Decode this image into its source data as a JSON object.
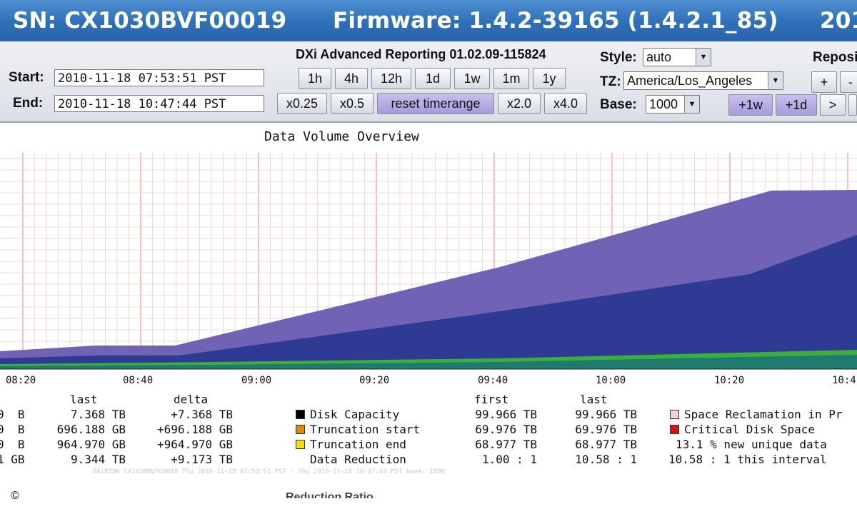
{
  "header": {
    "serial": "SN: CX1030BVF00019",
    "firmware": "Firmware: 1.4.2-39165 (1.4.2.1_85)",
    "year_cut": "201"
  },
  "toolbar": {
    "app_title": "DXi Advanced Reporting 01.02.09-115824",
    "start_label": "Start:",
    "start_value": "2010-11-18 07:53:51 PST",
    "end_label": "End:",
    "end_value": "2010-11-18 10:47:44 PST",
    "range_buttons": [
      "1h",
      "4h",
      "12h",
      "1d",
      "1w",
      "1m",
      "1y"
    ],
    "zoom_buttons": [
      "x0.25",
      "x0.5",
      "reset timerange",
      "x2.0",
      "x4.0"
    ],
    "style_label": "Style:",
    "style_value": "auto",
    "tz_label": "TZ:",
    "tz_value": "America/Los_Angeles",
    "base_label": "Base:",
    "base_value": "1000",
    "repos_label": "Reposi",
    "repos_buttons": [
      "+",
      "-"
    ],
    "shift_buttons": [
      "+1w",
      "+1d",
      ">"
    ]
  },
  "chart_data": {
    "type": "area",
    "title": "Data Volume Overview",
    "x_ticks": [
      "08:20",
      "08:40",
      "09:00",
      "09:20",
      "09:40",
      "10:00",
      "10:20",
      "10:4"
    ],
    "grid": true,
    "series": [
      {
        "color": "#7062b4",
        "role": "top"
      },
      {
        "color": "#2e3a94",
        "role": "middle"
      },
      {
        "color": "#3cae3a",
        "role": "line"
      },
      {
        "color": "#1f7a70",
        "role": "base"
      }
    ]
  },
  "legend": {
    "left_headers": {
      "last": "last",
      "delta": "delta"
    },
    "left_rows": [
      {
        "prefix": "0  B",
        "last": "7.368 TB",
        "delta": "+7.368 TB"
      },
      {
        "prefix": "0  B",
        "last": "696.188 GB",
        "delta": "+696.188 GB"
      },
      {
        "prefix": "0  B",
        "last": "964.970 GB",
        "delta": "+964.970 GB"
      },
      {
        "prefix": "1 GB",
        "last": "9.344 TB",
        "delta": "+9.173 TB"
      }
    ],
    "mid_headers": {
      "first": "first",
      "last": "last"
    },
    "mid_rows": [
      {
        "label": "Disk Capacity",
        "color": "#000000",
        "first": "99.966 TB",
        "last": "99.966 TB"
      },
      {
        "label": "Truncation start",
        "color": "#e08a10",
        "first": "69.976 TB",
        "last": "69.976 TB"
      },
      {
        "label": "Truncation end",
        "color": "#f0e010",
        "first": "68.977 TB",
        "last": "68.977 TB"
      },
      {
        "label": "Data Reduction",
        "first": "1.00 : 1",
        "last": "10.58 : 1"
      }
    ],
    "right_rows": [
      {
        "label": "Space Reclamation in Pr",
        "color": "#f4d0d8"
      },
      {
        "label": "Critical Disk Space",
        "color": "#d01818"
      },
      {
        "label": "13.1 % new unique data"
      },
      {
        "label": "10.58 : 1 this interval"
      }
    ]
  },
  "footer": {
    "faint_text": "DXiRTDR  CX1030BVF00019  Thu 2010-11-18 07:53:51 PST - Thu 2010-11-18 10:47:44 PST  base: 1000",
    "next_title": "Reduction Ratio",
    "copyright": "©"
  }
}
